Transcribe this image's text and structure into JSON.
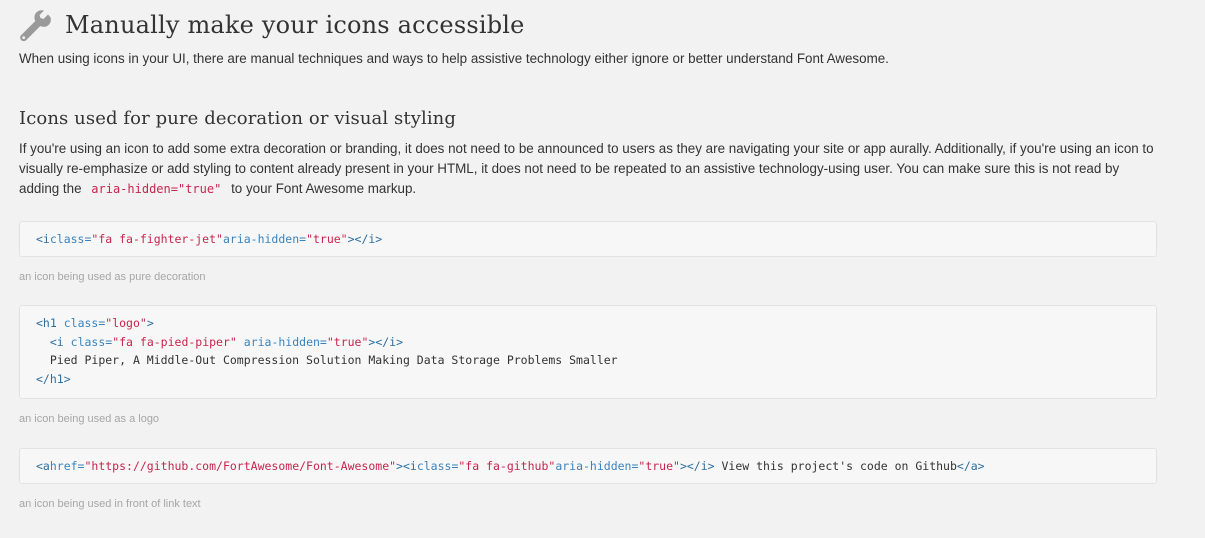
{
  "heading": {
    "icon": "wrench-icon",
    "title": "Manually make your icons accessible",
    "intro": "When using icons in your UI, there are manual techniques and ways to help assistive technology either ignore or better understand Font Awesome."
  },
  "section": {
    "title": "Icons used for pure decoration or visual styling",
    "body_before": "If you're using an icon to add some extra decoration or branding, it does not need to be announced to users as they are navigating your site or app aurally. Additionally, if you're using an icon to visually re-emphasize or add styling to content already present in your HTML, it does not need to be repeated to an assistive technology-using user. You can make sure this is not read by adding the",
    "inline_code": "aria-hidden=\"true\"",
    "body_after": "to your Font Awesome markup."
  },
  "examples": [
    {
      "caption": "an icon being used as pure decoration",
      "code": {
        "open": "<i",
        "class_attr": "class=",
        "class_val": "\"fa fa-fighter-jet\"",
        "aria_attr": "aria-hidden=",
        "aria_val": "\"true\"",
        "close": "></i>"
      }
    },
    {
      "caption": "an icon being used as a logo",
      "code": {
        "h1_open": "<h1",
        "h1_class_attr": "class=",
        "h1_class_val": "\"logo\"",
        "h1_gt": ">",
        "i_open": "<i",
        "i_class_attr": "class=",
        "i_class_val": "\"fa fa-pied-piper\"",
        "i_aria_attr": "aria-hidden=",
        "i_aria_val": "\"true\"",
        "i_close": "></i>",
        "text": "Pied Piper, A Middle-Out Compression Solution Making Data Storage Problems Smaller",
        "h1_close": "</h1>"
      }
    },
    {
      "caption": "an icon being used in front of link text",
      "code": {
        "a_open": "<a",
        "href_attr": "href=",
        "href_val": "\"https://github.com/FortAwesome/Font-Awesome\"",
        "gt_i_open": "><i",
        "class_attr": "class=",
        "class_val": "\"fa fa-github\"",
        "aria_attr": "aria-hidden=",
        "aria_val": "\"true\"",
        "i_close": "></i>",
        "text": " View this project's code on Github",
        "a_close": "</a>"
      }
    }
  ],
  "colors": {
    "background": "#f2f2f2",
    "code_bg": "#f7f7f7",
    "string": "#c7254e",
    "attribute": "#3a83bd",
    "caption": "#a6a6a6"
  }
}
